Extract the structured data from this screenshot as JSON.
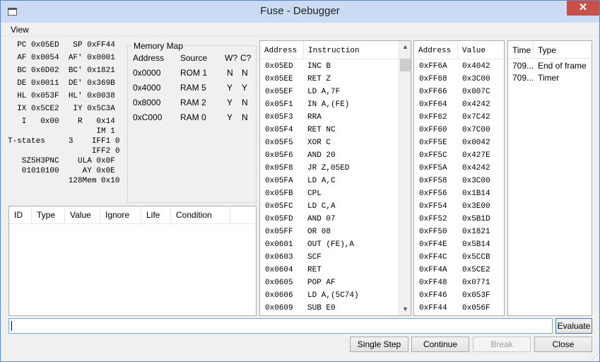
{
  "window": {
    "title": "Fuse - Debugger",
    "close_glyph": "✕"
  },
  "menu": {
    "view": "View"
  },
  "registers": [
    "  PC 0x05ED   SP 0xFF44",
    "  AF 0x0054  AF' 0x0001",
    "  BC 0x6D02  BC' 0x1821",
    "  DE 0x0011  DE' 0x369B",
    "  HL 0x053F  HL' 0x0038",
    "  IX 0x5CE2   IY 0x5C3A",
    "   I   0x00    R   0x14",
    "                   IM 1",
    "T-states     3    IFF1 0",
    "                  IFF2 0",
    "   SZ5H3PNC    ULA 0x0F",
    "   01010100     AY 0x0E",
    "             128Mem 0x10"
  ],
  "memory_map": {
    "title": "Memory Map",
    "headers": {
      "address": "Address",
      "source": "Source",
      "writable": "W?",
      "contended": "C?"
    },
    "rows": [
      {
        "address": "0x0000",
        "source": "ROM 1",
        "writable": "N",
        "contended": "N"
      },
      {
        "address": "0x4000",
        "source": "RAM 5",
        "writable": "Y",
        "contended": "Y"
      },
      {
        "address": "0x8000",
        "source": "RAM 2",
        "writable": "Y",
        "contended": "N"
      },
      {
        "address": "0xC000",
        "source": "RAM 0",
        "writable": "Y",
        "contended": "N"
      }
    ]
  },
  "breakpoints": {
    "headers": {
      "id": "ID",
      "type": "Type",
      "value": "Value",
      "ignore": "Ignore",
      "life": "Life",
      "condition": "Condition"
    }
  },
  "disassembly": {
    "headers": {
      "address": "Address",
      "instruction": "Instruction"
    },
    "rows": [
      {
        "address": "0x05ED",
        "instruction": "INC B"
      },
      {
        "address": "0x05EE",
        "instruction": "RET Z"
      },
      {
        "address": "0x05EF",
        "instruction": "LD A,7F"
      },
      {
        "address": "0x05F1",
        "instruction": "IN A,(FE)"
      },
      {
        "address": "0x05F3",
        "instruction": "RRA"
      },
      {
        "address": "0x05F4",
        "instruction": "RET NC"
      },
      {
        "address": "0x05F5",
        "instruction": "XOR C"
      },
      {
        "address": "0x05F6",
        "instruction": "AND 20"
      },
      {
        "address": "0x05F8",
        "instruction": "JR Z,05ED"
      },
      {
        "address": "0x05FA",
        "instruction": "LD A,C"
      },
      {
        "address": "0x05FB",
        "instruction": "CPL"
      },
      {
        "address": "0x05FC",
        "instruction": "LD C,A"
      },
      {
        "address": "0x05FD",
        "instruction": "AND 07"
      },
      {
        "address": "0x05FF",
        "instruction": "OR 08"
      },
      {
        "address": "0x0601",
        "instruction": "OUT (FE),A"
      },
      {
        "address": "0x0603",
        "instruction": "SCF"
      },
      {
        "address": "0x0604",
        "instruction": "RET"
      },
      {
        "address": "0x0605",
        "instruction": "POP AF"
      },
      {
        "address": "0x0606",
        "instruction": "LD A,(5C74)"
      },
      {
        "address": "0x0609",
        "instruction": "SUB E0"
      }
    ]
  },
  "stack": {
    "headers": {
      "address": "Address",
      "value": "Value"
    },
    "rows": [
      {
        "address": "0xFF6A",
        "value": "0x4042"
      },
      {
        "address": "0xFF68",
        "value": "0x3C00"
      },
      {
        "address": "0xFF66",
        "value": "0x007C"
      },
      {
        "address": "0xFF64",
        "value": "0x4242"
      },
      {
        "address": "0xFF62",
        "value": "0x7C42"
      },
      {
        "address": "0xFF60",
        "value": "0x7C00"
      },
      {
        "address": "0xFF5E",
        "value": "0x0042"
      },
      {
        "address": "0xFF5C",
        "value": "0x427E"
      },
      {
        "address": "0xFF5A",
        "value": "0x4242"
      },
      {
        "address": "0xFF58",
        "value": "0x3C00"
      },
      {
        "address": "0xFF56",
        "value": "0x1B14"
      },
      {
        "address": "0xFF54",
        "value": "0x3E00"
      },
      {
        "address": "0xFF52",
        "value": "0x5B1D"
      },
      {
        "address": "0xFF50",
        "value": "0x1821"
      },
      {
        "address": "0xFF4E",
        "value": "0x5B14"
      },
      {
        "address": "0xFF4C",
        "value": "0x5CCB"
      },
      {
        "address": "0xFF4A",
        "value": "0x5CE2"
      },
      {
        "address": "0xFF48",
        "value": "0x0771"
      },
      {
        "address": "0xFF46",
        "value": "0x053F"
      },
      {
        "address": "0xFF44",
        "value": "0x056F"
      }
    ]
  },
  "events": {
    "headers": {
      "time": "Time",
      "type": "Type"
    },
    "rows": [
      {
        "time": "709...",
        "type": "End of frame"
      },
      {
        "time": "709...",
        "type": "Timer"
      }
    ]
  },
  "evaluate": {
    "value": "",
    "button": "Evaluate"
  },
  "buttons": {
    "single_step": "Single Step",
    "continue": "Continue",
    "break": "Break",
    "close": "Close"
  },
  "scroll_glyphs": {
    "up": "▲",
    "down": "▼"
  }
}
